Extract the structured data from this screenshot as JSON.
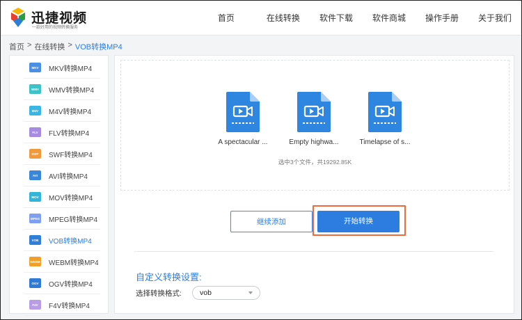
{
  "header": {
    "logo_title": "迅捷视频",
    "logo_slogan": "一款好用的视频转换服务",
    "nav": [
      "首页",
      "在线转换",
      "软件下载",
      "软件商城",
      "操作手册",
      "关于我们"
    ]
  },
  "breadcrumb": {
    "home": "首页",
    "sep": ">",
    "section": "在线转换",
    "current": "VOB转换MP4"
  },
  "sidebar": {
    "items": [
      {
        "icon": "MKV",
        "label": "MKV转换MP4",
        "color": "#4a8fe4"
      },
      {
        "icon": "WMV",
        "label": "WMV转换MP4",
        "color": "#3ec2c8"
      },
      {
        "icon": "M4V",
        "label": "M4V转换MP4",
        "color": "#3ab6e4"
      },
      {
        "icon": "FLV",
        "label": "FLV转换MP4",
        "color": "#a68be0"
      },
      {
        "icon": "SWF",
        "label": "SWF转换MP4",
        "color": "#f29a3b"
      },
      {
        "icon": "AVI",
        "label": "AVI转换MP4",
        "color": "#3a86d8"
      },
      {
        "icon": "MOV",
        "label": "MOV转换MP4",
        "color": "#32b5d8"
      },
      {
        "icon": "MPEG",
        "label": "MPEG转换MP4",
        "color": "#7f9ff0"
      },
      {
        "icon": "VOB",
        "label": "VOB转换MP4",
        "color": "#2f7fd9"
      },
      {
        "icon": "WEBM",
        "label": "WEBM转换MP4",
        "color": "#f0a02a"
      },
      {
        "icon": "OGV",
        "label": "OGV转换MP4",
        "color": "#2d7bd6"
      },
      {
        "icon": "F4V",
        "label": "F4V转换MP4",
        "color": "#b89de6"
      }
    ],
    "active_index": 8
  },
  "files": [
    {
      "name": "A spectacular ..."
    },
    {
      "name": "Empty highwa..."
    },
    {
      "name": "Timelapse of s..."
    }
  ],
  "summary": "选中3个文件，共19292.85K",
  "buttons": {
    "add": "继续添加",
    "start": "开始转换"
  },
  "settings": {
    "title": "自定义转换设置:",
    "format_label": "选择转换格式:",
    "format_value": "vob"
  },
  "colors": {
    "accent": "#2d7de0",
    "highlight": "#f0693a",
    "file_icon": "#2f86e0"
  }
}
